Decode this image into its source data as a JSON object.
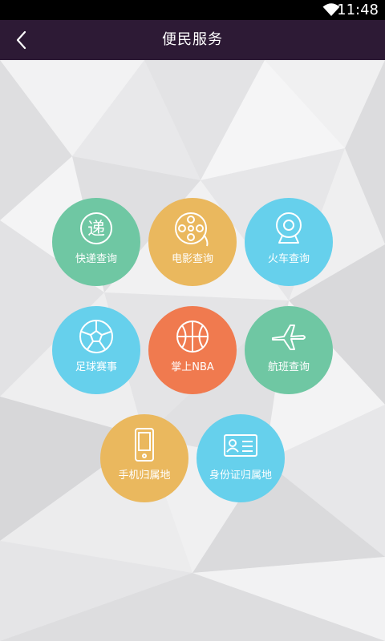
{
  "status_bar": {
    "time": "11:48",
    "wifi_icon": "wifi-icon"
  },
  "header": {
    "title": "便民服务",
    "back_icon": "chevron-left-icon"
  },
  "services": [
    {
      "label": "快递查询",
      "color": "#6fc7a3",
      "icon": "express-delivery-icon",
      "icon_char": "递"
    },
    {
      "label": "电影查询",
      "color": "#eab85e",
      "icon": "film-reel-icon"
    },
    {
      "label": "火车查询",
      "color": "#66d0ec",
      "icon": "webcam-icon"
    },
    {
      "label": "足球赛事",
      "color": "#66d0ec",
      "icon": "soccer-ball-icon"
    },
    {
      "label": "掌上NBA",
      "color": "#f07a4f",
      "icon": "basketball-icon"
    },
    {
      "label": "航班查询",
      "color": "#6fc7a3",
      "icon": "airplane-icon"
    },
    {
      "label": "手机归属地",
      "color": "#eab85e",
      "icon": "mobile-phone-icon"
    },
    {
      "label": "身份证归属地",
      "color": "#66d0ec",
      "icon": "id-card-icon"
    }
  ]
}
